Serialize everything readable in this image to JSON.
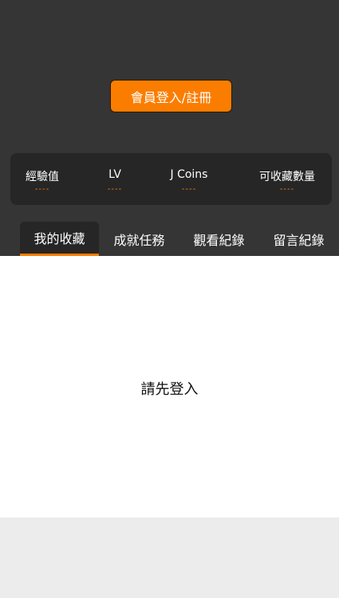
{
  "header": {
    "login_button": "會員登入/註冊"
  },
  "stats": [
    {
      "label": "經驗值",
      "value": "----"
    },
    {
      "label": "LV",
      "value": "----"
    },
    {
      "label": "J Coins",
      "value": "----"
    },
    {
      "label": "可收藏數量",
      "value": "----"
    }
  ],
  "tabs": [
    {
      "label": "我的收藏",
      "active": true
    },
    {
      "label": "成就任務",
      "active": false
    },
    {
      "label": "觀看紀錄",
      "active": false
    },
    {
      "label": "留言紀錄",
      "active": false
    }
  ],
  "content": {
    "empty_message": "請先登入"
  },
  "colors": {
    "accent": "#fb7d00",
    "header_bg": "#353535",
    "panel_bg": "#262626"
  }
}
